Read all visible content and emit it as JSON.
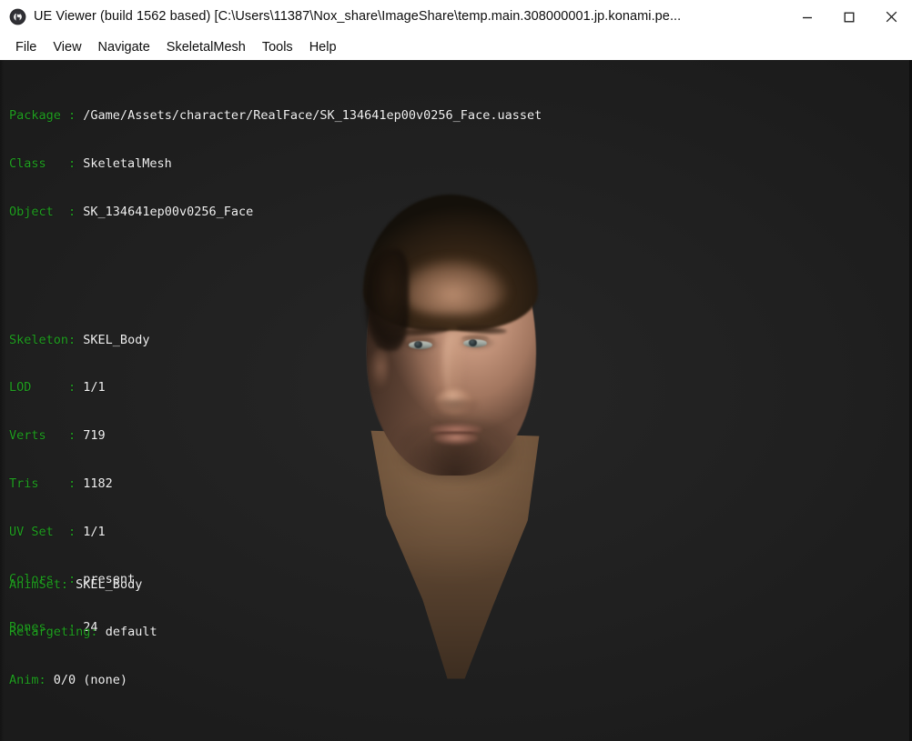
{
  "window": {
    "icon": "unreal-engine-logo-icon",
    "title": "UE Viewer (build 1562 based) [C:\\Users\\11387\\Nox_share\\ImageShare\\temp.main.308000001.jp.konami.pe...",
    "controls": {
      "minimize": "minimize-icon",
      "maximize": "maximize-icon",
      "close": "close-icon"
    }
  },
  "menu": {
    "items": [
      {
        "label": "File"
      },
      {
        "label": "View"
      },
      {
        "label": "Navigate"
      },
      {
        "label": "SkeletalMesh"
      },
      {
        "label": "Tools"
      },
      {
        "label": "Help"
      }
    ]
  },
  "viewport": {
    "background_color": "#1f1f1f",
    "label_color": "#21a021",
    "value_color": "#f2f2f2",
    "model": {
      "name": "skeletal-mesh-head-preview",
      "description": "3D character head"
    }
  },
  "info_overlay": {
    "rows": [
      {
        "label": "Package",
        "sep": " : ",
        "value": "/Game/Assets/character/RealFace/SK_134641ep00v0256_Face.uasset"
      },
      {
        "label": "Class",
        "sep": "   : ",
        "value": "SkeletalMesh"
      },
      {
        "label": "Object",
        "sep": "  : ",
        "value": "SK_134641ep00v0256_Face"
      }
    ],
    "stats": [
      {
        "label": "Skeleton:",
        "sep": " ",
        "value": "SKEL_Body"
      },
      {
        "label": "LOD",
        "sep": "     : ",
        "value": "1/1"
      },
      {
        "label": "Verts",
        "sep": "   : ",
        "value": "719"
      },
      {
        "label": "Tris",
        "sep": "    : ",
        "value": "1182"
      },
      {
        "label": "UV Set",
        "sep": "  : ",
        "value": "1/1"
      },
      {
        "label": "Colors",
        "sep": "  : ",
        "value": "present"
      },
      {
        "label": "Bones",
        "sep": "   : ",
        "value": "24"
      }
    ]
  },
  "status_overlay": {
    "rows": [
      {
        "label": "AnimSet:",
        "sep": " ",
        "value": "SKEL_Body"
      },
      {
        "label": "Retargeting:",
        "sep": " ",
        "value": "default"
      },
      {
        "label": "Anim:",
        "sep": " ",
        "value": "0/0 (none)"
      }
    ]
  }
}
